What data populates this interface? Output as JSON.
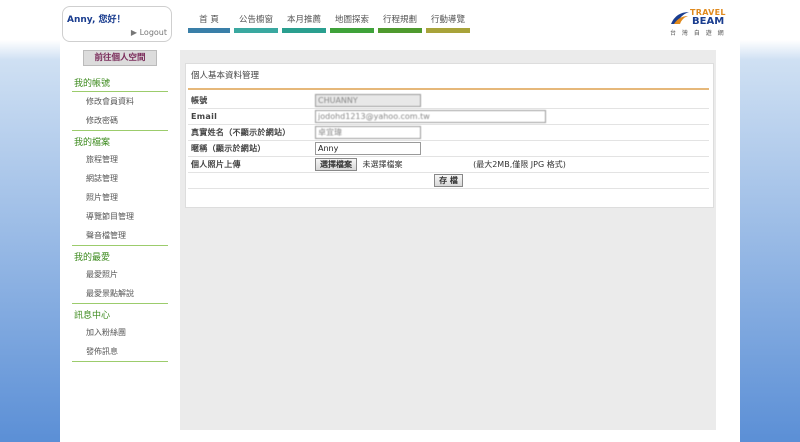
{
  "header": {
    "greeting": "Anny, 您好！",
    "logout": "▶ Logout",
    "nav": [
      {
        "label": "首  頁",
        "color": "#3a7fa8"
      },
      {
        "label": "公告櫥窗",
        "color": "#3aa8a0"
      },
      {
        "label": "本月推薦",
        "color": "#2a9f8f"
      },
      {
        "label": "地圖探索",
        "color": "#3fa23a"
      },
      {
        "label": "行程規劃",
        "color": "#4f9a2e"
      },
      {
        "label": "行動導覽",
        "color": "#a8a33a"
      }
    ],
    "logo": {
      "line1": "TRAVEL",
      "line2": "BEAM",
      "line3": "台 灣 自 遊 網"
    }
  },
  "sidebar": {
    "go_button": "前往個人空間",
    "sections": [
      {
        "title": "我的帳號",
        "items": [
          "修改會員資料",
          "修改密碼"
        ]
      },
      {
        "title": "我的檔案",
        "items": [
          "旅程管理",
          "網誌管理",
          "照片管理",
          "導覽節目管理",
          "聲音檔管理"
        ]
      },
      {
        "title": "我的最愛",
        "items": [
          "最愛照片",
          "最愛景點解說"
        ]
      },
      {
        "title": "訊息中心",
        "items": [
          "加入粉絲團",
          "發佈訊息"
        ]
      }
    ]
  },
  "form": {
    "title": "個人基本資料管理",
    "account_label": "帳號",
    "account_value": "CHUANNY",
    "email_label": "Email",
    "email_value": "jodohd1213@yahoo.com.tw",
    "realname_label": "真實姓名（不顯示於網站）",
    "realname_value": "卓宜瑋",
    "nickname_label": "暱稱（顯示於網站）",
    "nickname_value": "Anny",
    "photo_label": "個人照片上傳",
    "choose_file_button": "選擇檔案",
    "no_file_text": "未選擇檔案",
    "file_hint": "(最大2MB,僅限 JPG 格式)",
    "save_button": "存 檔"
  }
}
